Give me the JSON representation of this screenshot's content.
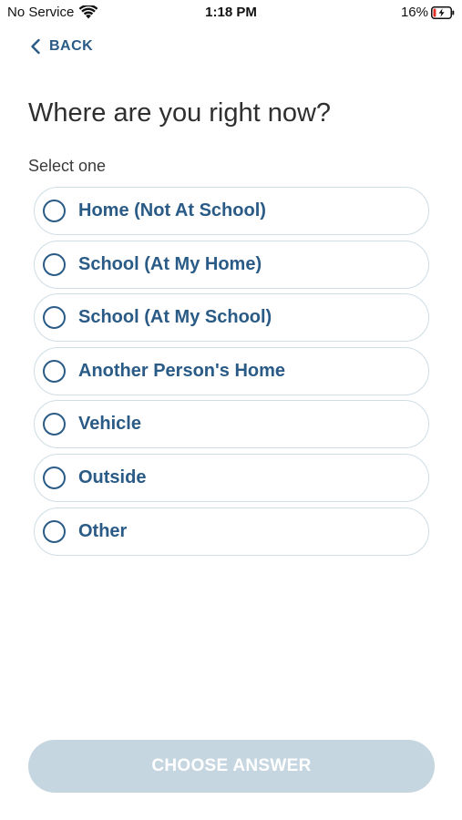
{
  "status_bar": {
    "carrier": "No Service",
    "time": "1:18 PM",
    "battery_percent": "16%",
    "battery_level": 0.16,
    "wifi_icon": "wifi-icon",
    "battery_icon": "battery-charging-icon"
  },
  "nav": {
    "back_label": "BACK",
    "back_icon": "chevron-left-icon"
  },
  "question": {
    "title": "Where are you right now?",
    "helper": "Select one"
  },
  "options": [
    {
      "label": "Home (Not At School)",
      "selected": false
    },
    {
      "label": "School (At My Home)",
      "selected": false
    },
    {
      "label": "School (At My School)",
      "selected": false
    },
    {
      "label": "Another Person's Home",
      "selected": false
    },
    {
      "label": "Vehicle",
      "selected": false
    },
    {
      "label": "Outside",
      "selected": false
    },
    {
      "label": "Other",
      "selected": false
    }
  ],
  "footer": {
    "choose_label": "CHOOSE ANSWER",
    "enabled": false
  },
  "colors": {
    "accent": "#2a5b86",
    "option_border": "#cfdde5",
    "button_disabled": "#c6d6e0"
  }
}
